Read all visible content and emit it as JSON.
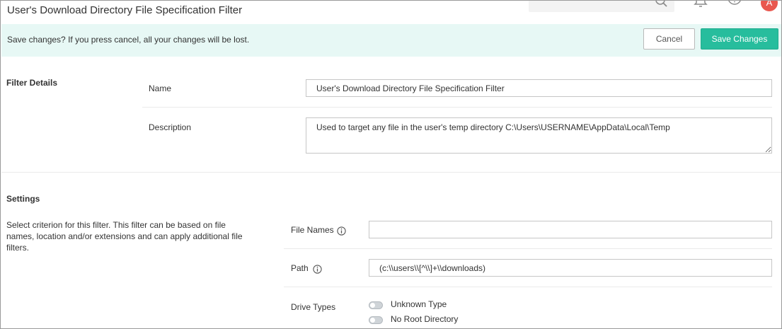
{
  "header": {
    "title": "User's Download Directory File Specification Filter",
    "avatar_initial": "A"
  },
  "save_bar": {
    "message": "Save changes? If you press cancel, all your changes will be lost.",
    "cancel_label": "Cancel",
    "save_label": "Save Changes"
  },
  "filter_details": {
    "heading": "Filter Details",
    "name_label": "Name",
    "name_value": "User's Download Directory File Specification Filter",
    "description_label": "Description",
    "description_value": "Used to target any file in the user's temp directory C:\\Users\\USERNAME\\AppData\\Local\\Temp"
  },
  "settings": {
    "heading": "Settings",
    "description": "Select criterion for this filter. This filter can be based on file names, location and/or extensions and can apply additional file filters.",
    "file_names_label": "File Names",
    "file_names_value": "",
    "path_label": "Path",
    "path_value": "(c:\\\\users\\\\[^\\\\]+\\\\downloads)",
    "drive_types_label": "Drive Types",
    "drive_types": [
      {
        "label": "Unknown Type",
        "enabled": false
      },
      {
        "label": "No Root Directory",
        "enabled": false
      }
    ]
  },
  "colors": {
    "accent": "#27bd9d",
    "save_bar_bg": "#e7f8f5",
    "avatar": "#e9584f"
  }
}
